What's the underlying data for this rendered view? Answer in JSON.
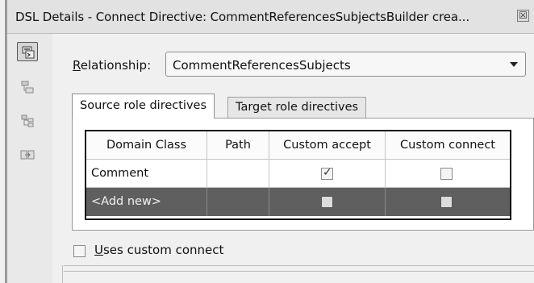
{
  "window": {
    "title": "DSL Details - Connect Directive: CommentReferencesSubjectsBuilder crea...",
    "close_glyph": "☒"
  },
  "sidebar": {
    "icons": [
      "connect-directive-icon",
      "element-merge-icon",
      "hierarchy-icon",
      "link-icon"
    ]
  },
  "relationship": {
    "label_accel": "R",
    "label_rest": "elationship:",
    "value": "CommentReferencesSubjects"
  },
  "tabs": [
    {
      "label": "Source role directives",
      "selected": true
    },
    {
      "label": "Target role directives",
      "selected": false
    }
  ],
  "grid": {
    "columns": [
      "Domain Class",
      "Path",
      "Custom accept",
      "Custom connect"
    ],
    "rows": [
      {
        "domain_class": "Comment",
        "path": "",
        "custom_accept": true,
        "custom_connect": false
      },
      {
        "domain_class": "<Add new>",
        "path": "",
        "custom_accept": false,
        "custom_connect": false
      }
    ]
  },
  "uses_custom_connect": {
    "label_accel": "U",
    "label_rest": "ses custom connect",
    "checked": false
  },
  "check_glyph": "✓"
}
